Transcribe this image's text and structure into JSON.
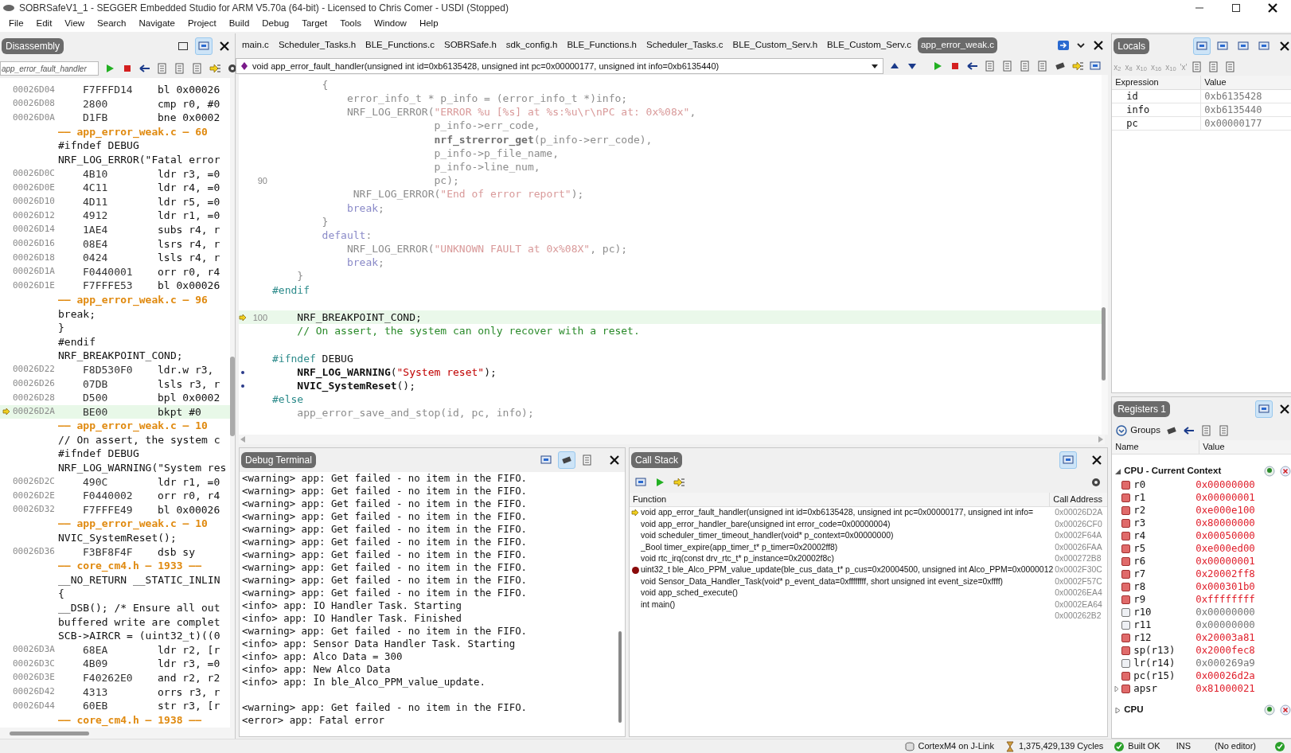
{
  "window": {
    "title": "SOBRSafeV1_1 - SEGGER Embedded Studio for ARM V5.70a (64-bit) - Licensed to Chris Comer - USDI (Stopped)"
  },
  "menu": [
    "File",
    "Edit",
    "View",
    "Search",
    "Navigate",
    "Project",
    "Build",
    "Debug",
    "Target",
    "Tools",
    "Window",
    "Help"
  ],
  "disassembly": {
    "title": "Disassembly",
    "search": {
      "value": "app_error_fault_handler"
    },
    "rows": [
      {
        "kind": "asm",
        "address": "00026D04",
        "opcode": "F7FFFD14",
        "instruction": "bl 0x00026",
        "current": false
      },
      {
        "kind": "asm",
        "address": "00026D08",
        "opcode": "2800",
        "instruction": "cmp r0, #0",
        "current": false
      },
      {
        "kind": "asm",
        "address": "00026D0A",
        "opcode": "D1FB",
        "instruction": "bne 0x0002",
        "current": false
      },
      {
        "kind": "file",
        "text": "—— app_error_weak.c — 60"
      },
      {
        "kind": "src",
        "text": "#ifndef DEBUG"
      },
      {
        "kind": "src",
        "text": "NRF_LOG_ERROR(\"Fatal error"
      },
      {
        "kind": "asm",
        "address": "00026D0C",
        "opcode": "4B10",
        "instruction": "ldr r3, =0",
        "current": false
      },
      {
        "kind": "asm",
        "address": "00026D0E",
        "opcode": "4C11",
        "instruction": "ldr r4, =0",
        "current": false
      },
      {
        "kind": "asm",
        "address": "00026D10",
        "opcode": "4D11",
        "instruction": "ldr r5, =0",
        "current": false
      },
      {
        "kind": "asm",
        "address": "00026D12",
        "opcode": "4912",
        "instruction": "ldr r1, =0",
        "current": false
      },
      {
        "kind": "asm",
        "address": "00026D14",
        "opcode": "1AE4",
        "instruction": "subs r4, r",
        "current": false
      },
      {
        "kind": "asm",
        "address": "00026D16",
        "opcode": "08E4",
        "instruction": "lsrs r4, r",
        "current": false
      },
      {
        "kind": "asm",
        "address": "00026D18",
        "opcode": "0424",
        "instruction": "lsls r4, r",
        "current": false
      },
      {
        "kind": "asm",
        "address": "00026D1A",
        "opcode": "F0440001",
        "instruction": "orr r0, r4",
        "current": false
      },
      {
        "kind": "asm",
        "address": "00026D1E",
        "opcode": "F7FFFE53",
        "instruction": "bl 0x00026",
        "current": false
      },
      {
        "kind": "file",
        "text": "—— app_error_weak.c — 96"
      },
      {
        "kind": "src",
        "text": "break;"
      },
      {
        "kind": "src",
        "text": "}"
      },
      {
        "kind": "src",
        "text": "#endif"
      },
      {
        "kind": "src",
        "text": "NRF_BREAKPOINT_COND;"
      },
      {
        "kind": "asm",
        "address": "00026D22",
        "opcode": "F8D530F0",
        "instruction": "ldr.w r3,",
        "current": false
      },
      {
        "kind": "asm",
        "address": "00026D26",
        "opcode": "07DB",
        "instruction": "lsls r3, r",
        "current": false
      },
      {
        "kind": "asm",
        "address": "00026D28",
        "opcode": "D500",
        "instruction": "bpl 0x0002",
        "current": false
      },
      {
        "kind": "asm",
        "address": "00026D2A",
        "opcode": "BE00",
        "instruction": "bkpt #0",
        "current": true
      },
      {
        "kind": "file",
        "text": "—— app_error_weak.c — 10"
      },
      {
        "kind": "src",
        "text": "// On assert, the system c"
      },
      {
        "kind": "src",
        "text": "#ifndef DEBUG"
      },
      {
        "kind": "src",
        "text": "NRF_LOG_WARNING(\"System res"
      },
      {
        "kind": "asm",
        "address": "00026D2C",
        "opcode": "490C",
        "instruction": "ldr r1, =0",
        "current": false
      },
      {
        "kind": "asm",
        "address": "00026D2E",
        "opcode": "F0440002",
        "instruction": "orr r0, r4",
        "current": false
      },
      {
        "kind": "asm",
        "address": "00026D32",
        "opcode": "F7FFFE49",
        "instruction": "bl 0x00026",
        "current": false
      },
      {
        "kind": "file",
        "text": "—— app_error_weak.c — 10"
      },
      {
        "kind": "src",
        "text": "NVIC_SystemReset();"
      },
      {
        "kind": "asm",
        "address": "00026D36",
        "opcode": "F3BF8F4F",
        "instruction": "dsb sy",
        "current": false
      },
      {
        "kind": "file",
        "text": "—— core_cm4.h — 1933 ——"
      },
      {
        "kind": "src",
        "text": "__NO_RETURN __STATIC_INLIN"
      },
      {
        "kind": "src",
        "text": "{"
      },
      {
        "kind": "src",
        "text": "__DSB(); /* Ensure all out"
      },
      {
        "kind": "src",
        "text": "buffered write are complet"
      },
      {
        "kind": "src",
        "text": "SCB->AIRCR = (uint32_t)((0"
      },
      {
        "kind": "asm",
        "address": "00026D3A",
        "opcode": "68EA",
        "instruction": "ldr r2, [r",
        "current": false
      },
      {
        "kind": "asm",
        "address": "00026D3C",
        "opcode": "4B09",
        "instruction": "ldr r3, =0",
        "current": false
      },
      {
        "kind": "asm",
        "address": "00026D3E",
        "opcode": "F40262E0",
        "instruction": "and r2, r2",
        "current": false
      },
      {
        "kind": "asm",
        "address": "00026D42",
        "opcode": "4313",
        "instruction": "orrs r3, r",
        "current": false
      },
      {
        "kind": "asm",
        "address": "00026D44",
        "opcode": "60EB",
        "instruction": "str r3, [r",
        "current": false
      },
      {
        "kind": "file",
        "text": "—— core_cm4.h — 1938 ——"
      }
    ]
  },
  "editor": {
    "tabs": [
      {
        "label": "main.c",
        "selected": false
      },
      {
        "label": "Scheduler_Tasks.h",
        "selected": false
      },
      {
        "label": "BLE_Functions.c",
        "selected": false
      },
      {
        "label": "SOBRSafe.h",
        "selected": false
      },
      {
        "label": "sdk_config.h",
        "selected": false
      },
      {
        "label": "BLE_Functions.h",
        "selected": false
      },
      {
        "label": "Scheduler_Tasks.c",
        "selected": false
      },
      {
        "label": "BLE_Custom_Serv.h",
        "selected": false
      },
      {
        "label": "BLE_Custom_Serv.c",
        "selected": false
      },
      {
        "label": "app_error_weak.c",
        "selected": true
      }
    ],
    "function": "void app_error_fault_handler(unsigned int id=0xb6135428, unsigned int pc=0x00000177, unsigned int info=0xb6135440)",
    "lines": [
      {
        "kind": "code",
        "current": false,
        "code_marker": false,
        "segments": [
          {
            "text": "        {",
            "kind": "inactive"
          }
        ]
      },
      {
        "kind": "code",
        "current": false,
        "code_marker": false,
        "segments": [
          {
            "text": "            error_info_t * p_info = (error_info_t *)info;",
            "kind": "inactive"
          }
        ]
      },
      {
        "kind": "code",
        "current": false,
        "code_marker": false,
        "segments": [
          {
            "text": "            NRF_LOG_ERROR(",
            "kind": "inactive"
          },
          {
            "text": "\"ERROR %u [%s] at %s:%u\\r\\nPC at: 0x%08x\"",
            "kind": "inactive_string"
          },
          {
            "text": ",",
            "kind": "inactive"
          }
        ]
      },
      {
        "kind": "code",
        "current": false,
        "code_marker": false,
        "segments": [
          {
            "text": "                          p_info->err_code,",
            "kind": "inactive"
          }
        ]
      },
      {
        "kind": "code",
        "current": false,
        "code_marker": false,
        "segments": [
          {
            "text": "                          nrf_strerror_get",
            "kind": "inactive_bold"
          },
          {
            "text": "(p_info->err_code),",
            "kind": "inactive"
          }
        ]
      },
      {
        "kind": "code",
        "current": false,
        "code_marker": false,
        "segments": [
          {
            "text": "                          p_info->p_file_name,",
            "kind": "inactive"
          }
        ]
      },
      {
        "kind": "code",
        "current": false,
        "code_marker": false,
        "segments": [
          {
            "text": "                          p_info->line_num,",
            "kind": "inactive"
          }
        ]
      },
      {
        "kind": "code",
        "number": "90",
        "current": false,
        "code_marker": false,
        "segments": [
          {
            "text": "                          pc);",
            "kind": "inactive"
          }
        ]
      },
      {
        "kind": "code",
        "current": false,
        "code_marker": false,
        "segments": [
          {
            "text": "             NRF_LOG_ERROR(",
            "kind": "inactive"
          },
          {
            "text": "\"End of error report\"",
            "kind": "inactive_string"
          },
          {
            "text": ");",
            "kind": "inactive"
          }
        ]
      },
      {
        "kind": "code",
        "current": false,
        "code_marker": false,
        "segments": [
          {
            "text": "            break",
            "kind": "inactive_keyword"
          },
          {
            "text": ";",
            "kind": "inactive"
          }
        ]
      },
      {
        "kind": "code",
        "current": false,
        "code_marker": false,
        "segments": [
          {
            "text": "        }",
            "kind": "inactive"
          }
        ]
      },
      {
        "kind": "code",
        "current": false,
        "code_marker": false,
        "segments": [
          {
            "text": "        default",
            "kind": "inactive_keyword"
          },
          {
            "text": ":",
            "kind": "inactive"
          }
        ]
      },
      {
        "kind": "code",
        "current": false,
        "code_marker": false,
        "segments": [
          {
            "text": "            NRF_LOG_ERROR(",
            "kind": "inactive"
          },
          {
            "text": "\"UNKNOWN FAULT at 0x%08X\"",
            "kind": "inactive_string"
          },
          {
            "text": ", pc);",
            "kind": "inactive"
          }
        ]
      },
      {
        "kind": "code",
        "current": false,
        "code_marker": false,
        "segments": [
          {
            "text": "            break",
            "kind": "inactive_keyword"
          },
          {
            "text": ";",
            "kind": "inactive"
          }
        ]
      },
      {
        "kind": "code",
        "current": false,
        "code_marker": false,
        "segments": [
          {
            "text": "    }",
            "kind": "inactive"
          }
        ]
      },
      {
        "kind": "code",
        "current": false,
        "code_marker": false,
        "segments": [
          {
            "text": "#endif",
            "kind": "preproc"
          }
        ]
      },
      {
        "kind": "blank"
      },
      {
        "kind": "code",
        "number": "100",
        "current": true,
        "code_marker": false,
        "segments": [
          {
            "text": "    NRF_BREAKPOINT_COND;",
            "kind": "plain"
          }
        ]
      },
      {
        "kind": "code",
        "current": false,
        "code_marker": false,
        "segments": [
          {
            "text": "    // On assert, the system can only recover with a reset.",
            "kind": "comment"
          }
        ]
      },
      {
        "kind": "blank"
      },
      {
        "kind": "code",
        "current": false,
        "code_marker": false,
        "segments": [
          {
            "text": "#ifndef",
            "kind": "preproc"
          },
          {
            "text": " DEBUG",
            "kind": "plain"
          }
        ]
      },
      {
        "kind": "code",
        "current": false,
        "code_marker": true,
        "segments": [
          {
            "text": "    NRF_LOG_WARNING",
            "kind": "bold"
          },
          {
            "text": "(",
            "kind": "plain"
          },
          {
            "text": "\"System reset\"",
            "kind": "string"
          },
          {
            "text": ");",
            "kind": "plain"
          }
        ]
      },
      {
        "kind": "code",
        "current": false,
        "code_marker": true,
        "segments": [
          {
            "text": "    NVIC_SystemReset",
            "kind": "bold"
          },
          {
            "text": "();",
            "kind": "plain"
          }
        ]
      },
      {
        "kind": "code",
        "current": false,
        "code_marker": false,
        "segments": [
          {
            "text": "#else",
            "kind": "preproc"
          }
        ]
      },
      {
        "kind": "code",
        "current": false,
        "code_marker": false,
        "segments": [
          {
            "text": "    app_error_save_and_stop(id, pc, info);",
            "kind": "inactive"
          }
        ]
      }
    ]
  },
  "terminal": {
    "title": "Debug Terminal",
    "lines": [
      {
        "kind": "line",
        "text": "<warning> app: Get failed - no item in the FIFO."
      },
      {
        "kind": "line",
        "text": "<warning> app: Get failed - no item in the FIFO."
      },
      {
        "kind": "line",
        "text": "<warning> app: Get failed - no item in the FIFO."
      },
      {
        "kind": "line",
        "text": "<warning> app: Get failed - no item in the FIFO."
      },
      {
        "kind": "line",
        "text": "<warning> app: Get failed - no item in the FIFO."
      },
      {
        "kind": "line",
        "text": "<warning> app: Get failed - no item in the FIFO."
      },
      {
        "kind": "line",
        "text": "<warning> app: Get failed - no item in the FIFO."
      },
      {
        "kind": "line",
        "text": "<warning> app: Get failed - no item in the FIFO."
      },
      {
        "kind": "line",
        "text": "<warning> app: Get failed - no item in the FIFO."
      },
      {
        "kind": "line",
        "text": "<warning> app: Get failed - no item in the FIFO."
      },
      {
        "kind": "line",
        "text": "<info> app: IO Handler Task. Starting"
      },
      {
        "kind": "line",
        "text": "<info> app: IO Handler Task. Finished"
      },
      {
        "kind": "line",
        "text": "<warning> app: Get failed - no item in the FIFO."
      },
      {
        "kind": "line",
        "text": "<info> app: Sensor Data Handler Task. Starting"
      },
      {
        "kind": "line",
        "text": "<info> app: Alco Data = 300"
      },
      {
        "kind": "line",
        "text": "<info> app: New Alco Data"
      },
      {
        "kind": "line",
        "text": "<info> app: In ble_Alco_PPM_value_update."
      },
      {
        "kind": "blank"
      },
      {
        "kind": "line",
        "text": "<warning> app: Get failed - no item in the FIFO."
      },
      {
        "kind": "line",
        "text": "<error> app: Fatal error"
      }
    ]
  },
  "call_stack": {
    "title": "Call Stack",
    "columns": [
      "Function",
      "Call Address"
    ],
    "rows": [
      {
        "current": true,
        "breakpoint": false,
        "function": "void app_error_fault_handler(unsigned int id=0xb6135428, unsigned int pc=0x00000177, unsigned int info=",
        "address": "0x00026D2A"
      },
      {
        "current": false,
        "breakpoint": false,
        "function": "void app_error_handler_bare(unsigned int error_code=0x00000004)",
        "address": "0x00026CF0"
      },
      {
        "current": false,
        "breakpoint": false,
        "function": "void scheduler_timer_timeout_handler(void* p_context=0x00000000)",
        "address": "0x0002F64A"
      },
      {
        "current": false,
        "breakpoint": false,
        "function": "_Bool timer_expire(app_timer_t* p_timer=0x20002ff8)",
        "address": "0x00026FAA"
      },
      {
        "current": false,
        "breakpoint": false,
        "function": "void rtc_irq(const drv_rtc_t* p_instance=0x20002f8c)",
        "address": "0x000272B8"
      },
      {
        "current": false,
        "breakpoint": true,
        "function": "uint32_t ble_Alco_PPM_value_update(ble_cus_data_t* p_cus=0x20004500, unsigned int Alco_PPM=0x0000012",
        "address": "0x0002F30C"
      },
      {
        "current": false,
        "breakpoint": false,
        "function": "void Sensor_Data_Handler_Task(void* p_event_data=0xffffffff, short unsigned int event_size=0xffff)",
        "address": "0x0002F57C"
      },
      {
        "current": false,
        "breakpoint": false,
        "function": "void app_sched_execute()",
        "address": "0x00026EA4"
      },
      {
        "current": false,
        "breakpoint": false,
        "function": "int main()",
        "address": "0x0002EA64"
      },
      {
        "current": false,
        "breakpoint": false,
        "address": "0x000262B2"
      }
    ]
  },
  "locals": {
    "title": "Locals",
    "formats": [
      "x$_{2}$",
      "x$_{8}$",
      "x$_{10}$",
      "x$_{16}$",
      "x$_{10}$",
      "'x'"
    ],
    "columns": [
      "Expression",
      "Value"
    ],
    "rows": [
      {
        "expression": "id",
        "value": "0xb6135428"
      },
      {
        "expression": "info",
        "value": "0xb6135440"
      },
      {
        "expression": "pc",
        "value": "0x00000177"
      }
    ]
  },
  "registers": {
    "title": "Registers 1",
    "groups_button": "Groups",
    "columns": [
      "Name",
      "Value"
    ],
    "groups": [
      {
        "name": "CPU - Current Context",
        "expanded": true,
        "registers": [
          {
            "name": "r0",
            "value": "0x00000000",
            "changed": true
          },
          {
            "name": "r1",
            "value": "0x00000001",
            "changed": true
          },
          {
            "name": "r2",
            "value": "0xe000e100",
            "changed": true
          },
          {
            "name": "r3",
            "value": "0x80000000",
            "changed": true
          },
          {
            "name": "r4",
            "value": "0x00050000",
            "changed": true
          },
          {
            "name": "r5",
            "value": "0xe000ed00",
            "changed": true
          },
          {
            "name": "r6",
            "value": "0x00000001",
            "changed": true
          },
          {
            "name": "r7",
            "value": "0x20002ff8",
            "changed": true
          },
          {
            "name": "r8",
            "value": "0x000301b0",
            "changed": true
          },
          {
            "name": "r9",
            "value": "0xffffffff",
            "changed": true
          },
          {
            "name": "r10",
            "value": "0x00000000",
            "changed": false
          },
          {
            "name": "r11",
            "value": "0x00000000",
            "changed": false
          },
          {
            "name": "r12",
            "value": "0x20003a81",
            "changed": true
          },
          {
            "name": "sp(r13)",
            "value": "0x2000fec8",
            "changed": true
          },
          {
            "name": "lr(r14)",
            "value": "0x000269a9",
            "changed": false
          },
          {
            "name": "pc(r15)",
            "value": "0x00026d2a",
            "changed": true
          },
          {
            "name": "apsr",
            "value": "0x81000021",
            "changed": true,
            "expandable": true
          }
        ]
      },
      {
        "name": "CPU",
        "expanded": false
      }
    ]
  },
  "status_bar": {
    "target": "CortexM4 on J-Link",
    "cycles": "1,375,429,139 Cycles",
    "build": "Built OK",
    "mode": "INS",
    "editor": "(No editor)"
  }
}
